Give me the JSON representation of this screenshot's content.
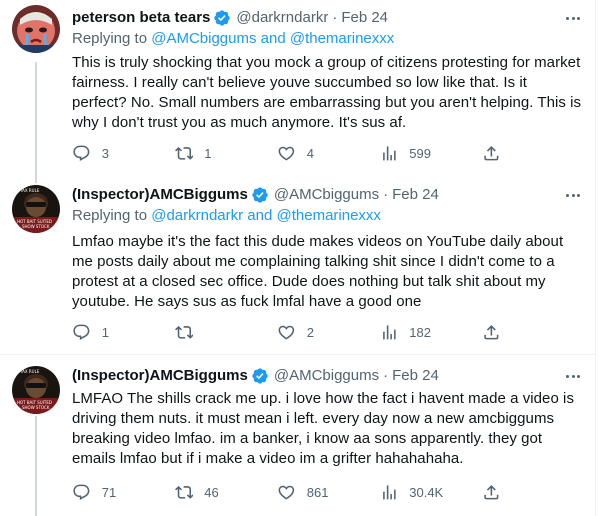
{
  "tweets": [
    {
      "display_name": "peterson beta tears",
      "handle": "@darkrndarkr",
      "separator": "·",
      "date": "Feb 24",
      "verified": true,
      "replying_prefix": "Replying to",
      "replying_mentions": "@AMCbiggums and @themarinexxx",
      "text": "This is truly shocking that you mock a group of citizens protesting for market fairness. I really can't believe youve succumbed so low like that. Is it perfect? No. Small numbers are embarrassing but you aren't helping. This is why I don't trust you as much anymore. It's sus af.",
      "replies": "3",
      "retweets": "1",
      "likes": "4",
      "views": "599"
    },
    {
      "display_name": "(Inspector)AMCBiggums",
      "handle": "@AMCbiggums",
      "separator": "·",
      "date": "Feb 24",
      "verified": true,
      "replying_prefix": "Replying to",
      "replying_mentions": "@darkrndarkr and @themarinexxx",
      "text": "Lmfao maybe it's the fact this dude makes videos on YouTube daily about me posts daily about me complaining talking shit since I didn't come to a protest at a closed sec office. Dude does nothing but talk shit about my youtube. He says sus as fuck lmfal have a good one",
      "replies": "1",
      "retweets": "",
      "likes": "2",
      "views": "182"
    },
    {
      "display_name": "(Inspector)AMCBiggums",
      "handle": "@AMCbiggums",
      "separator": "·",
      "date": "Feb 24",
      "verified": true,
      "text": "LMFAO The shills crack me up. i love how the fact i havent made a video is driving them nuts. it must mean i left. every day now a new amcbiggums breaking video lmfao. im a banker, i know aa sons apparently. they got emails lmfao but if i make a video im a grifter hahahahaha.",
      "replies": "71",
      "retweets": "46",
      "likes": "861",
      "views": "30.4K"
    }
  ],
  "icons": {
    "reply": "reply-icon",
    "retweet": "retweet-icon",
    "like": "like-icon",
    "views": "views-icon",
    "share": "share-icon",
    "more": "more-icon",
    "verified": "verified-badge-icon"
  },
  "colors": {
    "text": "#0f1419",
    "secondary": "#536471",
    "accent": "#1d9bf0",
    "border": "#eff3f4",
    "thread_line": "#cfd9de"
  }
}
